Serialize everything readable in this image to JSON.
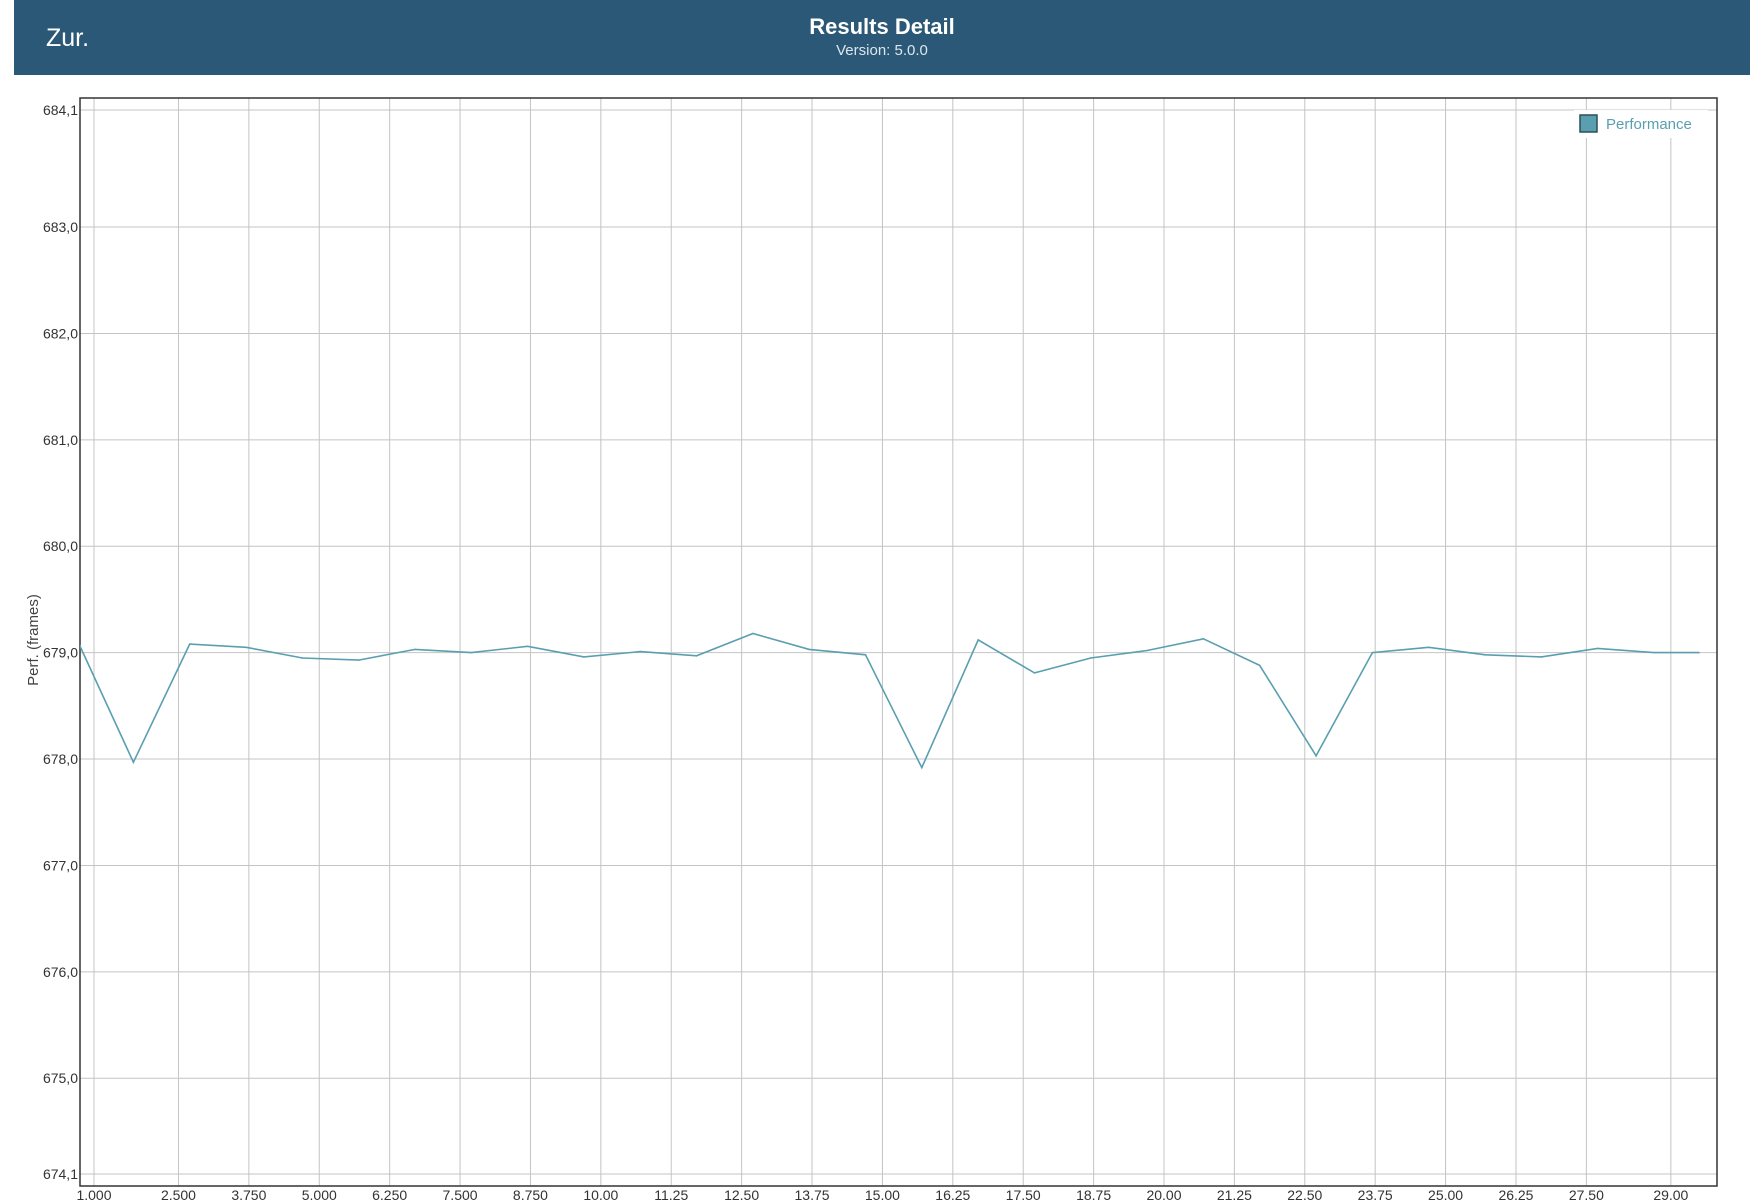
{
  "header": {
    "back_label": "Zur.",
    "title": "Results Detail",
    "subtitle": "Version: 5.0.0"
  },
  "colors": {
    "header_bg": "#2b5876",
    "series": "#5a9fb0",
    "grid": "#c4c4c4"
  },
  "chart_data": {
    "type": "line",
    "title": "",
    "xlabel": "",
    "ylabel": "Perf. (frames)",
    "xlim": [
      1.0,
      29.5
    ],
    "ylim": [
      674.1,
      684.1
    ],
    "x_ticks": [
      1.0,
      2.5,
      3.75,
      5.0,
      6.25,
      7.5,
      8.75,
      10.0,
      11.25,
      12.5,
      13.75,
      15.0,
      16.25,
      17.5,
      18.75,
      20.0,
      21.25,
      22.5,
      23.75,
      25.0,
      26.25,
      27.5,
      29.0
    ],
    "x_tick_labels": [
      "1,000",
      "2,500",
      "3,750",
      "5,000",
      "6,250",
      "7,500",
      "8,750",
      "10,00",
      "11,25",
      "12,50",
      "13,75",
      "15,00",
      "16,25",
      "17,50",
      "18,75",
      "20,00",
      "21,25",
      "22,50",
      "23,75",
      "25,00",
      "26,25",
      "27,50",
      "29,00"
    ],
    "y_ticks": [
      674.1,
      675.0,
      676.0,
      677.0,
      678.0,
      679.0,
      680.0,
      681.0,
      682.0,
      683.0,
      684.1
    ],
    "y_tick_labels": [
      "674,1",
      "675,0",
      "676,0",
      "677,0",
      "678,0",
      "679,0",
      "680,0",
      "681,0",
      "682,0",
      "683,0",
      "684,1"
    ],
    "grid": true,
    "legend": "top-right",
    "series": [
      {
        "name": "Performance",
        "x": [
          0.7,
          1.7,
          2.7,
          3.7,
          4.7,
          5.7,
          6.7,
          7.7,
          8.7,
          9.7,
          10.7,
          11.7,
          12.7,
          13.7,
          14.7,
          15.7,
          16.7,
          17.7,
          18.7,
          19.7,
          20.7,
          21.7,
          22.7,
          23.7,
          24.7,
          25.7,
          26.7,
          27.7,
          28.7,
          29.5
        ],
        "values": [
          679.12,
          677.97,
          679.08,
          679.05,
          678.95,
          678.93,
          679.03,
          679.0,
          679.06,
          678.96,
          679.01,
          678.97,
          679.18,
          679.03,
          678.98,
          677.92,
          679.12,
          678.81,
          678.95,
          679.02,
          679.13,
          678.88,
          678.03,
          679.0,
          679.05,
          678.98,
          678.96,
          679.04,
          679.0,
          679.0
        ]
      }
    ]
  }
}
